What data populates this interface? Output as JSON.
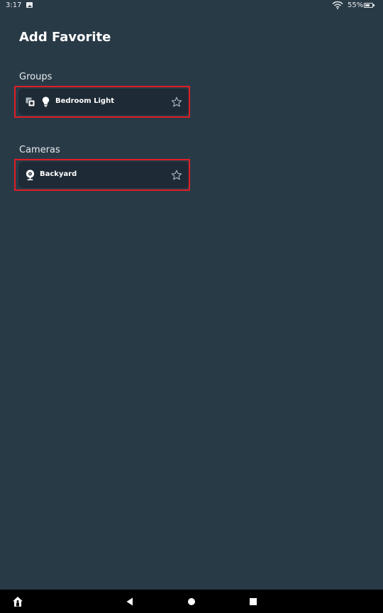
{
  "status_bar": {
    "time": "3:17",
    "battery_percent": "55%",
    "icons": [
      "image-icon",
      "wifi-icon",
      "battery-icon"
    ]
  },
  "page": {
    "title": "Add Favorite"
  },
  "sections": [
    {
      "label": "Groups",
      "items": [
        {
          "label": "Bedroom Light",
          "icons": [
            "group-icon",
            "bulb-icon",
            "star-outline-icon"
          ]
        }
      ]
    },
    {
      "label": "Cameras",
      "items": [
        {
          "label": "Backyard",
          "icons": [
            "camera-icon",
            "star-outline-icon"
          ]
        }
      ]
    }
  ],
  "nav_bar": {
    "buttons": [
      "alexa-home-icon",
      "back-icon",
      "home-icon",
      "recents-icon"
    ]
  },
  "colors": {
    "background": "#293a47",
    "card": "#1e2a35",
    "highlight": "#e01e26",
    "nav_bar": "#000000"
  }
}
